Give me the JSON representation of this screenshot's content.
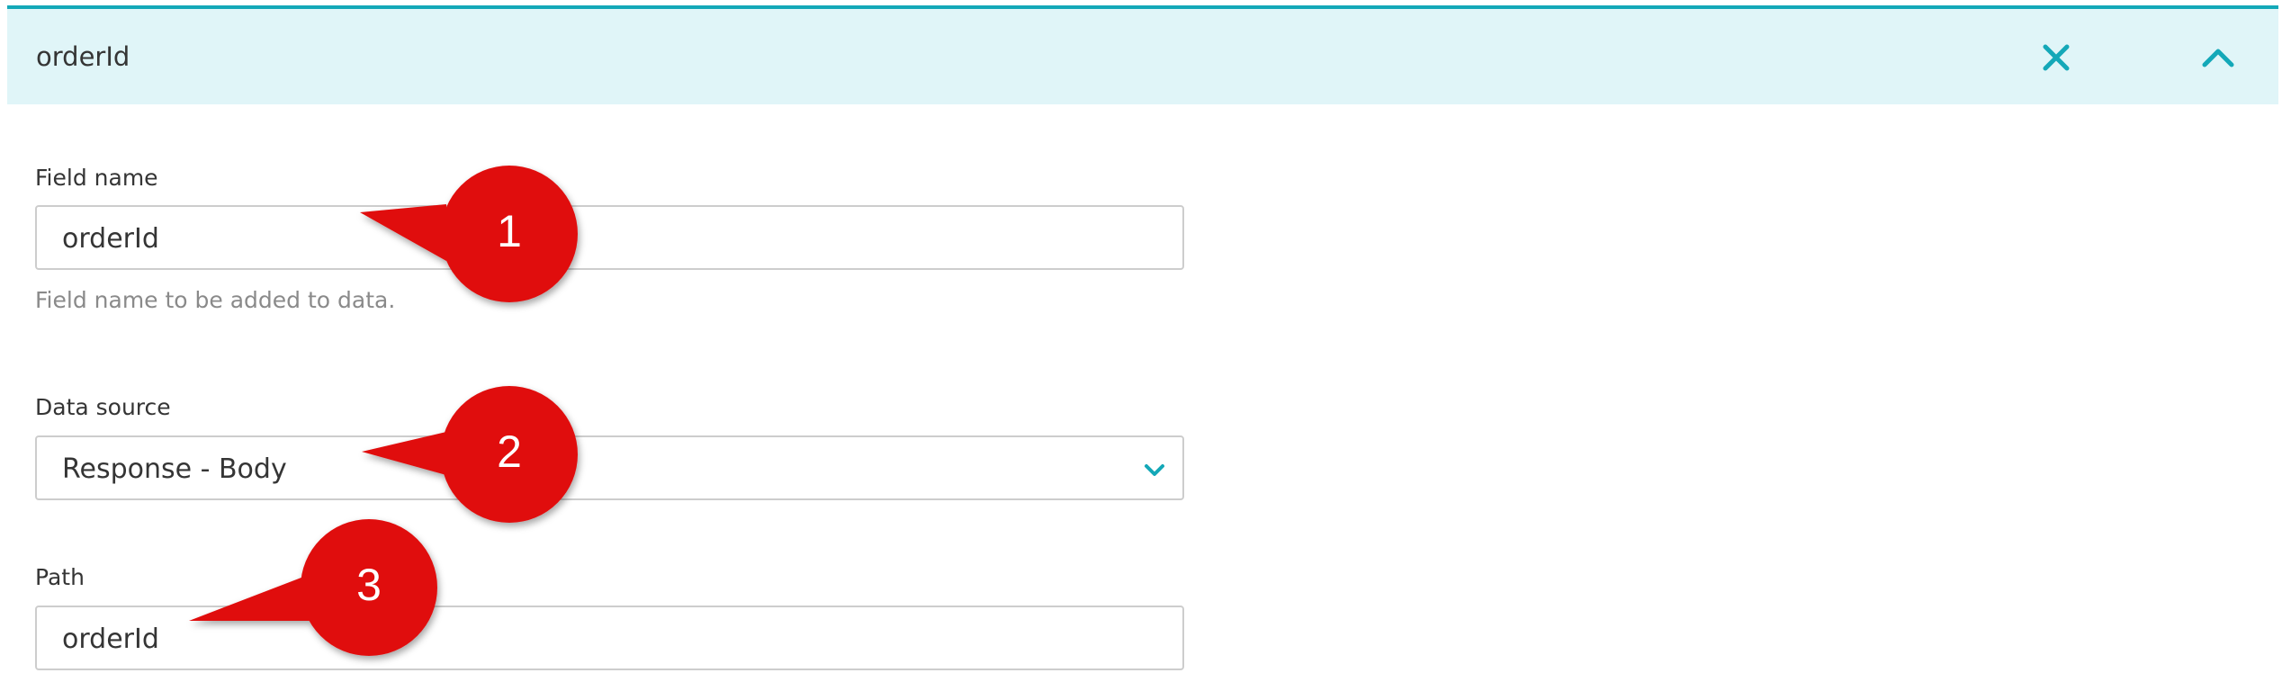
{
  "header": {
    "title": "orderId",
    "close_icon": "close-icon",
    "collapse_icon": "chevron-up-icon"
  },
  "form": {
    "field_name": {
      "label": "Field name",
      "value": "orderId",
      "help": "Field name to be added to data."
    },
    "data_source": {
      "label": "Data source",
      "value": "Response - Body",
      "caret_icon": "chevron-down-icon"
    },
    "path": {
      "label": "Path",
      "value": "orderId"
    }
  },
  "callouts": [
    "1",
    "2",
    "3"
  ],
  "colors": {
    "accent": "#14a8b8",
    "header_bg": "#e0f5f8",
    "callout_red": "#e00a0a"
  }
}
